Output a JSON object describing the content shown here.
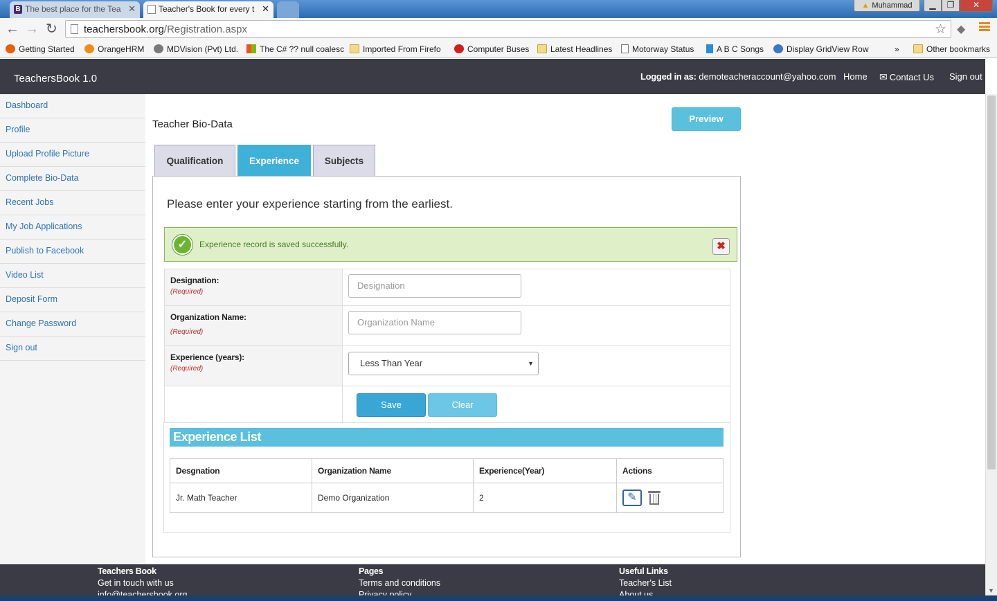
{
  "browser": {
    "tabs": [
      {
        "icon": "B",
        "title": "The best place for the Tea"
      },
      {
        "icon": "",
        "title": "Teacher's Book for every t"
      }
    ],
    "window_user": "Muhammad",
    "url_host": "teachersbook.org",
    "url_path": "/Registration.aspx",
    "bookmarks": [
      "Getting Started",
      "OrangeHRM",
      "MDVision (Pvt) Ltd.",
      "The C# ?? null coalesc",
      "Imported From Firefo",
      "Computer Buses",
      "Latest Headlines",
      "Motorway Status",
      "A B C Songs",
      "Display GridView Row",
      "»",
      "Other bookmarks"
    ]
  },
  "header": {
    "brand": "TeachersBook 1.0",
    "logged_label": "Logged in as:",
    "logged_email": "demoteacheraccount@yahoo.com",
    "home": "Home",
    "contact": "Contact Us",
    "signout": "Sign out"
  },
  "sidebar": {
    "items": [
      {
        "label": "Dashboard"
      },
      {
        "label": "Profile"
      },
      {
        "label": "Upload Profile Picture"
      },
      {
        "label": "Complete Bio-Data"
      },
      {
        "label": "Recent Jobs"
      },
      {
        "label": "My Job Applications"
      },
      {
        "label": "Publish to Facebook"
      },
      {
        "label": "Video List"
      },
      {
        "label": "Deposit Form"
      },
      {
        "label": "Change Password"
      },
      {
        "label": "Sign out"
      }
    ]
  },
  "main": {
    "title": "Teacher Bio-Data",
    "preview_label": "Preview",
    "tabs": [
      {
        "label": "Qualification"
      },
      {
        "label": "Experience"
      },
      {
        "label": "Subjects"
      }
    ],
    "intro": "Please enter your experience starting from the earliest.",
    "success_message": "Experience record is saved successfully.",
    "close_glyph": "✖",
    "form": {
      "designation_label": "Designation:",
      "designation_placeholder": "Designation",
      "organization_label": "Organization Name:",
      "organization_placeholder": "Organization Name",
      "experience_label": "Experience (years):",
      "experience_value": "Less Than Year",
      "required_text": "(Required)",
      "save_label": "Save",
      "clear_label": "Clear"
    },
    "experience_list": {
      "title": "Experience List",
      "columns": [
        "Desgnation",
        "Organization Name",
        "Experience(Year)",
        "Actions"
      ],
      "rows": [
        {
          "designation": "Jr. Math Teacher",
          "organization": "Demo Organization",
          "years": "2"
        }
      ]
    }
  },
  "footer": {
    "col1": {
      "heading": "Teachers Book",
      "line1": "Get in touch with us",
      "line2": "info@teachersbook.org"
    },
    "col2": {
      "heading": "Pages",
      "line1": "Terms and conditions",
      "line2": "Privacy policy"
    },
    "col3": {
      "heading": "Useful Links",
      "line1": "Teacher's List",
      "line2": "About us"
    }
  },
  "colors": {
    "accent": "#5bc0de",
    "header_bg": "#3b3b45",
    "link": "#2f73b5",
    "success_bg": "#dff0c8"
  }
}
